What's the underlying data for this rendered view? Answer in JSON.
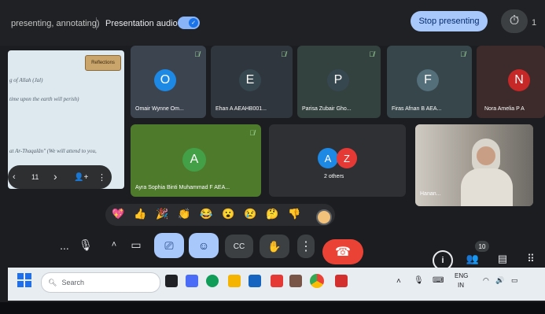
{
  "topbar": {
    "presenting_text": "presenting, annotating)",
    "audio_label": "Presentation audio",
    "stop_label": "Stop presenting",
    "timer_trailing": "1"
  },
  "presentation": {
    "sign_text": "Reflections",
    "lines": [
      "g of Allah (Jal)",
      "time upon the earth will perish)",
      "at Ar-Thaqalân\" (We will attend to you,"
    ],
    "page": "11"
  },
  "participants": [
    {
      "initial": "O",
      "name": "Omair Wynne Om...",
      "color": "#1e88e5"
    },
    {
      "initial": "E",
      "name": "Ehan A AEAHB001...",
      "color": "#37474f"
    },
    {
      "initial": "P",
      "name": "Parisa Zubair Gho...",
      "color": "#37474f"
    },
    {
      "initial": "F",
      "name": "Firas Afnan B AEA...",
      "color": "#546e7a"
    },
    {
      "initial": "N",
      "name": "Nora Amelia P A",
      "color": "#c62828"
    },
    {
      "initial": "A",
      "name": "Ayra Sophia Binti Muhammad F AEA...",
      "color": "#43a047"
    }
  ],
  "others": {
    "label": "2 others",
    "a": "A",
    "z": "Z"
  },
  "video_tile": {
    "name": "Hanan..."
  },
  "reactions": [
    "💖",
    "👍",
    "🎉",
    "👏",
    "😂",
    "😮",
    "😢",
    "🤔",
    "👎"
  ],
  "controls": {
    "more": "...",
    "people_badge": "10",
    "info": "i"
  },
  "taskbar": {
    "search_placeholder": "Search",
    "lang": "ENG",
    "region": "IN"
  }
}
